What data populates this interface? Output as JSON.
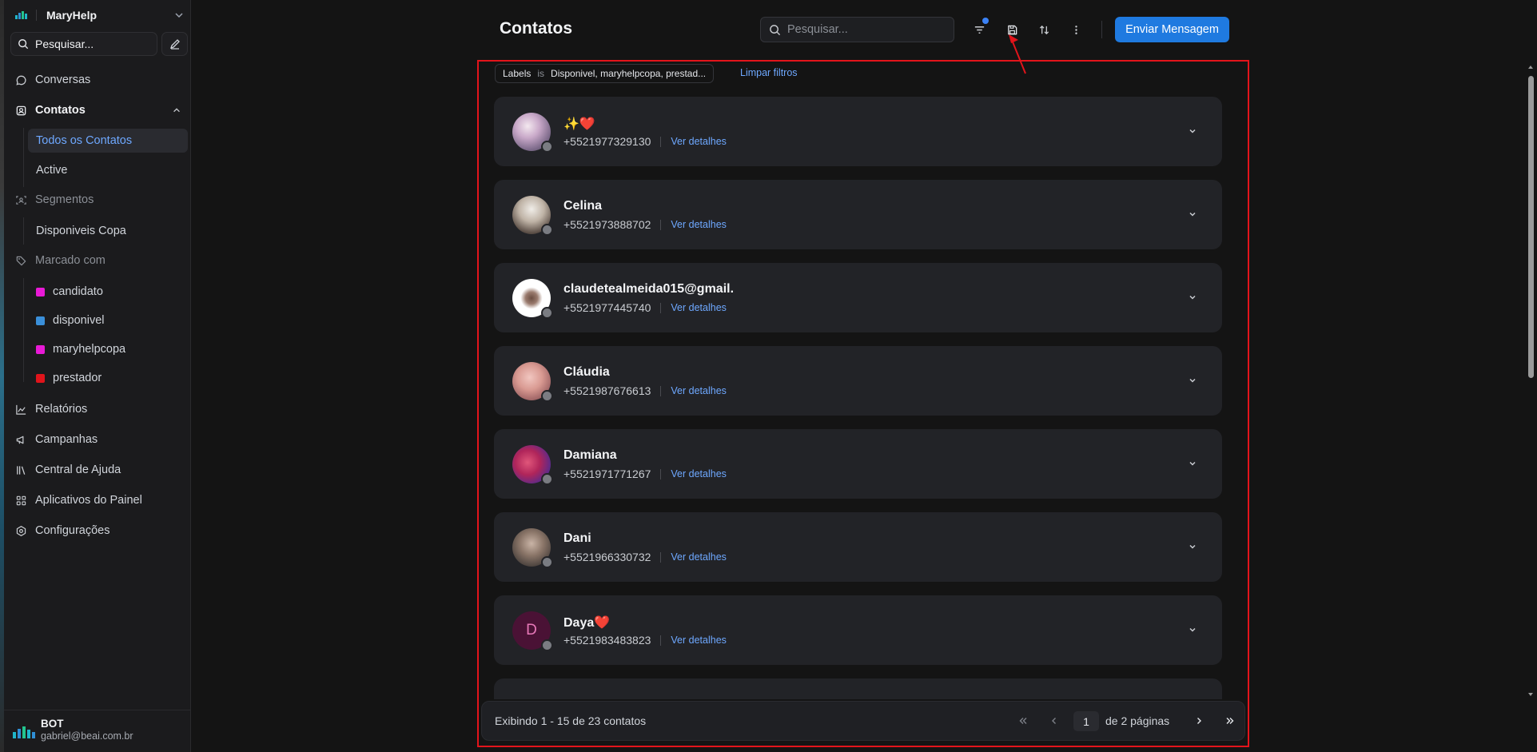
{
  "sidebar": {
    "brand": "MaryHelp",
    "search_label": "Pesquisar...",
    "nav": {
      "conversas": "Conversas",
      "contatos": "Contatos",
      "todos": "Todos os Contatos",
      "active": "Active",
      "segmentos": "Segmentos",
      "disponiveis_copa": "Disponiveis Copa",
      "marcado_com": "Marcado com",
      "relatorios": "Relatórios",
      "campanhas": "Campanhas",
      "central_ajuda": "Central de Ajuda",
      "aplicativos": "Aplicativos do Painel",
      "configuracoes": "Configurações"
    },
    "labels": [
      {
        "name": "candidato",
        "color": "#e81ad6"
      },
      {
        "name": "disponivel",
        "color": "#3a8fd9"
      },
      {
        "name": "maryhelpcopa",
        "color": "#e81ad6"
      },
      {
        "name": "prestador",
        "color": "#e0141b"
      }
    ],
    "user": {
      "name": "BOT",
      "email": "gabriel@beai.com.br"
    }
  },
  "header": {
    "title": "Contatos",
    "search_placeholder": "Pesquisar...",
    "send_button": "Enviar Mensagem",
    "accent": "#1f7ae0"
  },
  "filter": {
    "field": "Labels",
    "operator": "is",
    "value": "Disponivel, maryhelpcopa, prestad...",
    "clear": "Limpar filtros"
  },
  "contacts": [
    {
      "name": "✨❤️",
      "phone": "+5521977329130",
      "details": "Ver detalhes"
    },
    {
      "name": "Celina",
      "phone": "+5521973888702",
      "details": "Ver detalhes"
    },
    {
      "name": "claudetealmeida015@gmail.",
      "phone": "+5521977445740",
      "details": "Ver detalhes"
    },
    {
      "name": "Cláudia",
      "phone": "+5521987676613",
      "details": "Ver detalhes"
    },
    {
      "name": "Damiana",
      "phone": "+5521971771267",
      "details": "Ver detalhes"
    },
    {
      "name": "Dani",
      "phone": "+5521966330732",
      "details": "Ver detalhes"
    },
    {
      "name": "Daya❤️",
      "phone": "+5521983483823",
      "details": "Ver detalhes",
      "initial": "D"
    }
  ],
  "pagination": {
    "info": "Exibindo 1 - 15 de 23 contatos",
    "current_page": "1",
    "total": "de 2 páginas"
  }
}
